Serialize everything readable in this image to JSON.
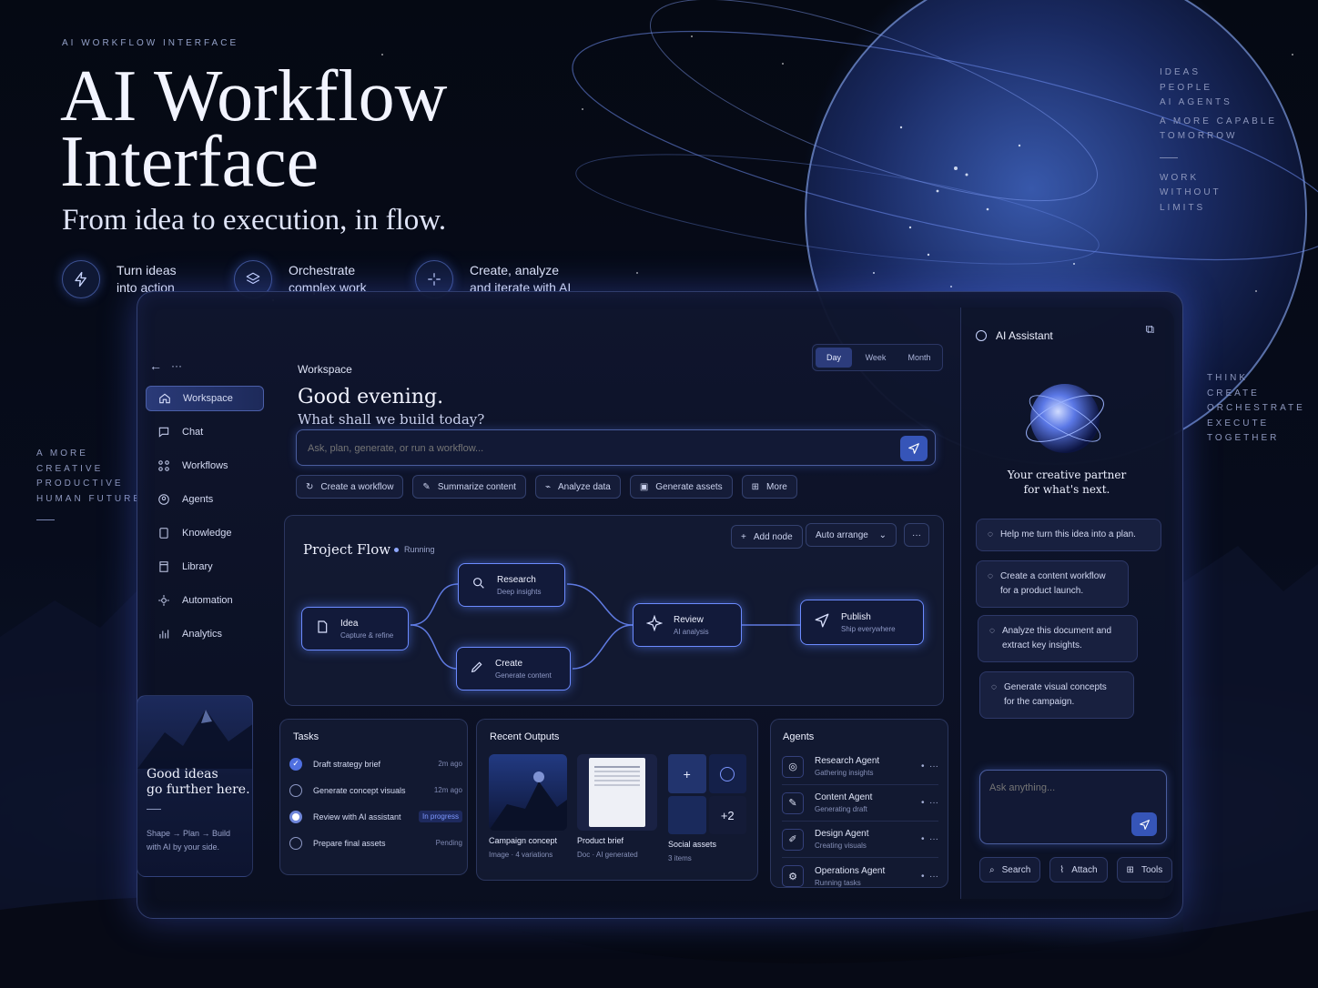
{
  "hero": {
    "kicker": "AI WORKFLOW INTERFACE",
    "title_line1": "AI Workflow",
    "title_line2": "Interface",
    "subtitle": "From idea to execution, in flow.",
    "features": [
      {
        "icon": "lightning-icon",
        "line1": "Turn ideas",
        "line2": "into action"
      },
      {
        "icon": "layers-icon",
        "line1": "Orchestrate",
        "line2": "complex work"
      },
      {
        "icon": "sparkle-icon",
        "line1": "Create, analyze",
        "line2": "and iterate with AI"
      }
    ]
  },
  "right_top_list": [
    "IDEAS",
    "PEOPLE",
    "AI AGENTS",
    "A MORE CAPABLE",
    "TOMORROW"
  ],
  "right_mid_list": [
    "WORK",
    "WITHOUT",
    "LIMITS"
  ],
  "right_lower_list": [
    "THINK",
    "CREATE",
    "ORCHESTRATE",
    "EXECUTE",
    "TOGETHER"
  ],
  "left_list": [
    "A MORE",
    "CREATIVE",
    "PRODUCTIVE",
    "HUMAN FUTURE"
  ],
  "sidebar": {
    "top_icons": [
      "arrow-left-icon",
      "more-icon"
    ],
    "items": [
      {
        "label": "Workspace",
        "icon": "home-icon"
      },
      {
        "label": "Chat",
        "icon": "chat-icon"
      },
      {
        "label": "Workflows",
        "icon": "workflow-icon"
      },
      {
        "label": "Agents",
        "icon": "agent-icon"
      },
      {
        "label": "Knowledge",
        "icon": "book-icon"
      },
      {
        "label": "Library",
        "icon": "library-icon"
      },
      {
        "label": "Automation",
        "icon": "automation-icon"
      },
      {
        "label": "Analytics",
        "icon": "analytics-icon"
      }
    ],
    "promo": {
      "title_line1": "Good ideas",
      "title_line2": "go further here.",
      "desc_line1": "Shape → Plan → Build",
      "desc_line2": "with AI by your side."
    }
  },
  "main": {
    "section": "Workspace",
    "greeting": "Good evening.",
    "question": "What shall we build today?",
    "range_tabs": [
      "Day",
      "Week",
      "Month"
    ],
    "active_tab": "Day",
    "prompt_placeholder": "Ask, plan, generate, or run a workflow...",
    "quick_actions": [
      "Create a workflow",
      "Summarize content",
      "Analyze data",
      "Generate assets",
      "More"
    ],
    "flow": {
      "title": "Project Flow",
      "status": "Running",
      "add_node": "Add node",
      "arrange": "Auto arrange",
      "nodes": [
        {
          "title": "Idea",
          "sub": "Capture & refine"
        },
        {
          "title": "Research",
          "sub": "Deep insights"
        },
        {
          "title": "Create",
          "sub": "Generate content"
        },
        {
          "title": "Review",
          "sub": "AI analysis"
        },
        {
          "title": "Publish",
          "sub": "Ship everywhere"
        }
      ]
    },
    "tasks": {
      "title": "Tasks",
      "items": [
        {
          "label": "Draft strategy brief",
          "status": "2m ago"
        },
        {
          "label": "Generate concept visuals",
          "status": "12m ago"
        },
        {
          "label": "Review with AI assistant",
          "status": "In progress"
        },
        {
          "label": "Prepare final assets",
          "status": "Pending"
        }
      ]
    },
    "outputs": {
      "title": "Recent Outputs",
      "items": [
        {
          "title": "Campaign concept",
          "sub": "Image · 4 variations"
        },
        {
          "title": "Product brief",
          "sub": "Doc · AI generated"
        },
        {
          "title": "Social assets",
          "sub": "3 items",
          "more": "+2"
        }
      ]
    },
    "agents": {
      "title": "Agents",
      "items": [
        {
          "name": "Research Agent",
          "sub": "Gathering insights"
        },
        {
          "name": "Content Agent",
          "sub": "Generating draft"
        },
        {
          "name": "Design Agent",
          "sub": "Creating visuals"
        },
        {
          "name": "Operations Agent",
          "sub": "Running tasks"
        }
      ]
    }
  },
  "assistant": {
    "title": "AI Assistant",
    "tagline_line1": "Your creative partner",
    "tagline_line2": "for what's next.",
    "suggestions": [
      {
        "l1": "Help me turn this idea into a plan.",
        "l2": ""
      },
      {
        "l1": "Create a content workflow",
        "l2": "for a product launch."
      },
      {
        "l1": "Analyze this document and",
        "l2": "extract key insights."
      },
      {
        "l1": "Generate visual concepts",
        "l2": "for the campaign."
      }
    ],
    "input_placeholder": "Ask anything...",
    "buttons": [
      "Search",
      "Attach",
      "Tools"
    ]
  }
}
